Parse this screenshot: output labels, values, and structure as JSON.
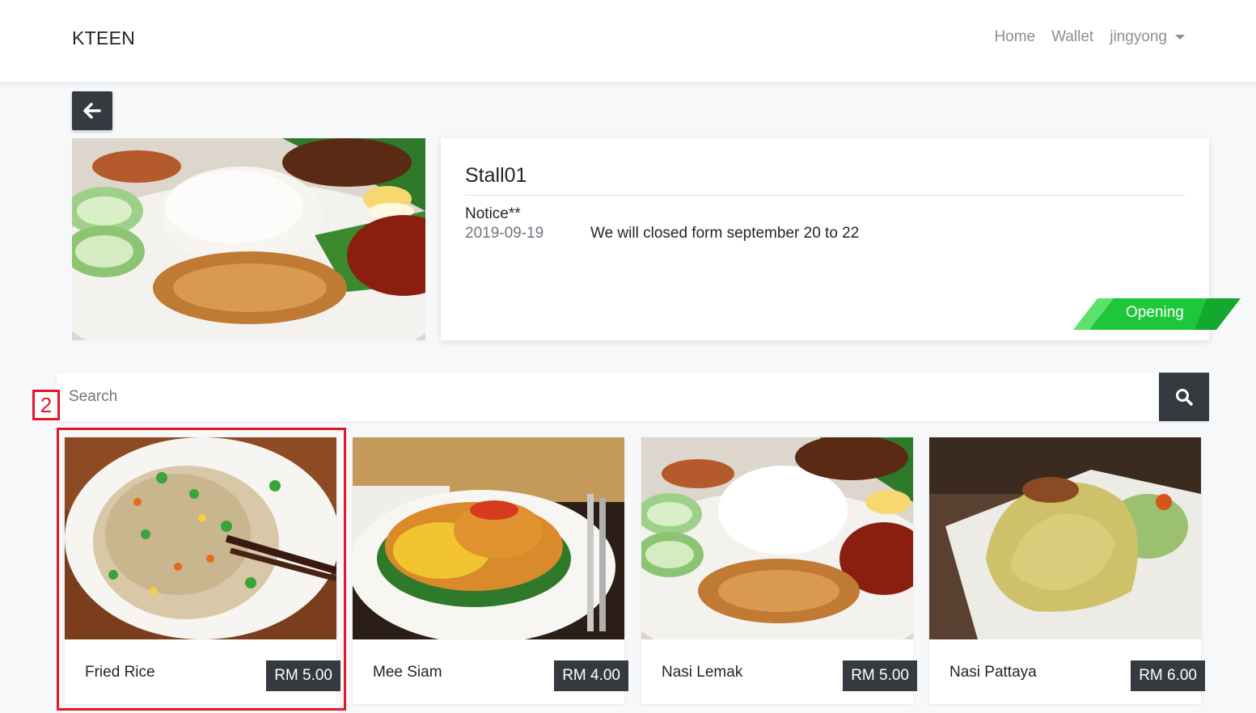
{
  "navbar": {
    "brand": "KTEEN",
    "links": [
      "Home",
      "Wallet"
    ],
    "user": "jingyong"
  },
  "stall": {
    "name": "Stall01",
    "notice_title": "Notice**",
    "notice_date": "2019-09-19",
    "notice_text": "We will closed form september 20 to 22",
    "status": "Opening",
    "status_color": "#1ec73a"
  },
  "search": {
    "placeholder": "Search"
  },
  "annotation": {
    "label": "2",
    "color": "#e0182a"
  },
  "menu": [
    {
      "name": "Fried Rice",
      "price": "RM 5.00"
    },
    {
      "name": "Mee Siam",
      "price": "RM 4.00"
    },
    {
      "name": "Nasi Lemak",
      "price": "RM 5.00"
    },
    {
      "name": "Nasi Pattaya",
      "price": "RM 6.00"
    }
  ]
}
